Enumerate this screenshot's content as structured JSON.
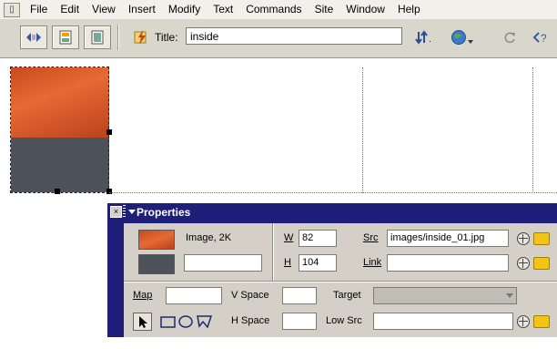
{
  "menubar": {
    "items": [
      "File",
      "Edit",
      "View",
      "Insert",
      "Modify",
      "Text",
      "Commands",
      "Site",
      "Window",
      "Help"
    ]
  },
  "toolbar": {
    "title_label": "Title:",
    "title_value": "inside",
    "file_mgmt_label": "Jt."
  },
  "properties": {
    "panel_title": "Properties",
    "image_desc": "Image, 2K",
    "w_label": "W",
    "w_value": "82",
    "h_label": "H",
    "h_value": "104",
    "src_label": "Src",
    "src_value": "images/inside_01.jpg",
    "link_label": "Link",
    "link_value": "",
    "map_label": "Map",
    "map_value": "",
    "vspace_label": "V Space",
    "hspace_label": "H Space",
    "target_label": "Target",
    "lowsrc_label": "Low Src",
    "name_value": ""
  },
  "colors": {
    "panel_frame": "#1f1e7b",
    "panel_body": "#d4d0c8",
    "orange_image": "#e56a33",
    "slate_image": "#4d525a"
  }
}
